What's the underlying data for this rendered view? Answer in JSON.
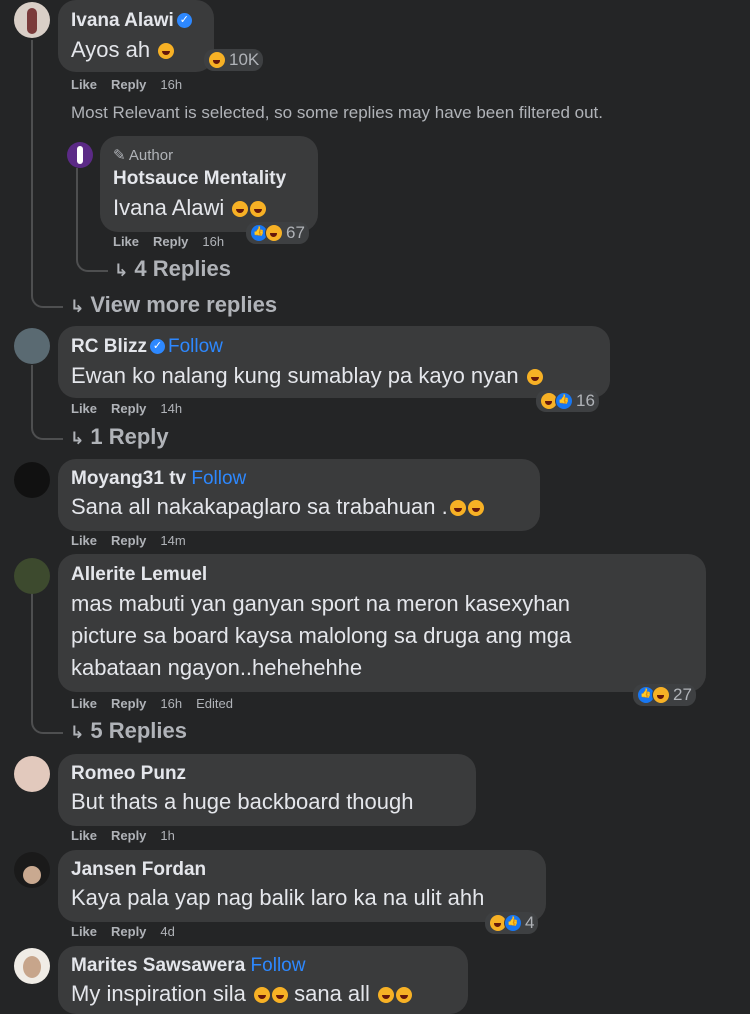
{
  "actions": {
    "like": "Like",
    "reply": "Reply",
    "follow": "Follow",
    "edited": "Edited"
  },
  "comments": [
    {
      "name": "Ivana Alawi",
      "text": "Ayos ah",
      "time": "16h",
      "reactions": "10K"
    },
    {
      "name": "RC Blizz",
      "text": "Ewan ko nalang kung sumablay pa kayo nyan",
      "time": "14h",
      "reactions": "16",
      "replies": "1 Reply"
    },
    {
      "name": "Moyang31 tv",
      "text": "Sana all nakakapaglaro sa trabahuan .",
      "time": "14m"
    },
    {
      "name": "Allerite Lemuel",
      "lines": [
        "mas mabuti yan ganyan sport na meron kasexyhan",
        "picture sa board kaysa malolong sa druga ang mga",
        "kabataan ngayon..hehehehhe"
      ],
      "time": "16h",
      "reactions": "27",
      "replies": "5 Replies"
    },
    {
      "name": "Romeo Punz",
      "text": "But thats a huge backboard though",
      "time": "1h"
    },
    {
      "name": "Jansen Fordan",
      "text": "Kaya pala yap nag balik laro ka na ulit ahh",
      "time": "4d",
      "reactions": "4"
    },
    {
      "name": "Marites Sawsawera",
      "text": "My inspiration sila",
      "text2": "sana all"
    }
  ],
  "notice": "Most Relevant is selected, so some replies may have been filtered out.",
  "reply": {
    "tag": "Author",
    "name": "Hotsauce Mentality",
    "text": "Ivana Alawi",
    "time": "16h",
    "reactions": "67",
    "replies": "4 Replies"
  },
  "view_more": "View more replies",
  "colors": {
    "background": "#242526",
    "bubble": "#3a3b3c",
    "link": "#2d88ff",
    "muted": "#b0b3b8"
  }
}
